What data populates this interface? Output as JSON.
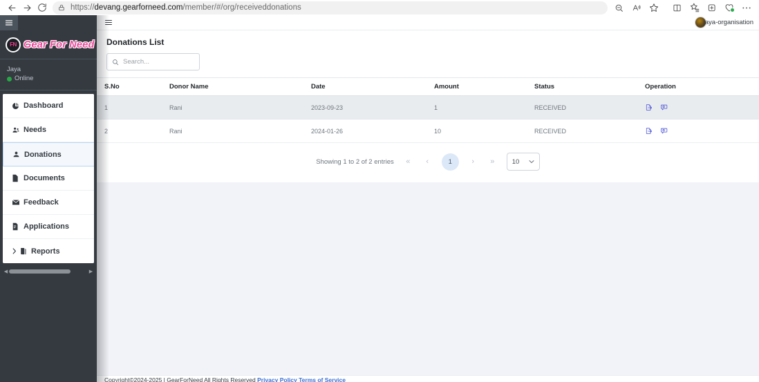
{
  "browser": {
    "url_prefix": "https://",
    "url_host": "devang.gearforneed.com",
    "url_path": "/member/#/org/receiveddonations",
    "back_icon": "back-arrow-icon",
    "forward_icon": "forward-arrow-icon",
    "reload_icon": "reload-icon",
    "lock_icon": "lock-icon",
    "right_icons": [
      {
        "name": "zoom-out-icon",
        "glyph": "zoom"
      },
      {
        "name": "read-aloud-icon",
        "glyph": "read"
      },
      {
        "name": "favorite-star-icon",
        "glyph": "star"
      },
      {
        "name": "split-screen-icon",
        "glyph": "split"
      },
      {
        "name": "collections-icon",
        "glyph": "collections"
      },
      {
        "name": "add-tab-group-icon",
        "glyph": "addgroup"
      },
      {
        "name": "browser-essentials-icon",
        "glyph": "essentials"
      },
      {
        "name": "settings-more-icon",
        "glyph": "more"
      }
    ]
  },
  "sidebar": {
    "toggle_icon": "hamburger-icon",
    "brand_badge": "FN",
    "brand_name": "Gear For Need",
    "user_name": "Jaya",
    "user_status": "Online",
    "items": [
      {
        "label": "Dashboard",
        "icon": "dashboard-pie-icon",
        "active": false,
        "caret": false
      },
      {
        "label": "Needs",
        "icon": "people-icon",
        "active": false,
        "caret": false
      },
      {
        "label": "Donations",
        "icon": "donation-hand-icon",
        "active": true,
        "caret": false
      },
      {
        "label": "Documents",
        "icon": "document-icon",
        "active": false,
        "caret": false
      },
      {
        "label": "Feedback",
        "icon": "envelope-icon",
        "active": false,
        "caret": false
      },
      {
        "label": "Applications",
        "icon": "application-file-icon",
        "active": false,
        "caret": false
      },
      {
        "label": "Reports",
        "icon": "reports-book-icon",
        "active": false,
        "caret": true
      }
    ],
    "scroll_left_arrow": "◀",
    "scroll_right_arrow": "▶"
  },
  "topnav": {
    "burger_icon": "hamburger-icon",
    "username": "jaya-organisation",
    "avatar_name": "user-avatar"
  },
  "main": {
    "page_title": "Donations List",
    "search_placeholder": "Search...",
    "search_value": "",
    "search_icon": "search-icon",
    "table": {
      "columns": [
        "S.No",
        "Donor Name",
        "Date",
        "Amount",
        "Status",
        "Operation"
      ],
      "rows": [
        {
          "sno": "1",
          "donor": "Rani",
          "date": "2023-09-23",
          "amount": "1",
          "status": "RECEIVED"
        },
        {
          "sno": "2",
          "donor": "Rani",
          "date": "2024-01-26",
          "amount": "10",
          "status": "RECEIVED"
        }
      ],
      "operation_icons": [
        "export-document-icon",
        "view-comment-icon"
      ]
    },
    "pagination": {
      "info": "Showing 1 to 2 of 2 entries",
      "first": "«",
      "prev": "‹",
      "current_page": "1",
      "next": "›",
      "last": "»",
      "page_size": "10",
      "chevron": "⌄"
    }
  },
  "footer": {
    "copyright": "Copyright©2024-2025 | GearForNeed All Rights Reserved ",
    "privacy_link": "Privacy Policy",
    "separator": " ",
    "terms_link": "Terms of Service"
  },
  "colors": {
    "sidebar_bg": "#343a40",
    "brand_pink": "#ec4899",
    "accent_blue": "#4a52d4",
    "page_bg": "#f2f3f8",
    "online_green": "#28a745"
  }
}
